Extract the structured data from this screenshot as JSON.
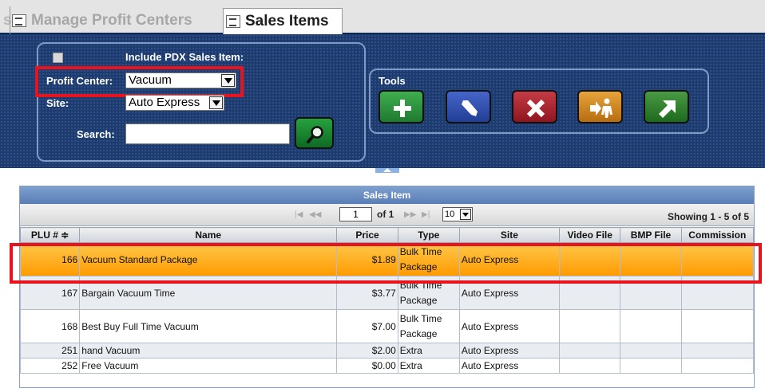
{
  "tabs": {
    "prev_tail": "s",
    "manage": "Manage Profit Centers",
    "sales": "Sales Items"
  },
  "filters": {
    "include_pdx_label": "Include PDX Sales Item:",
    "profit_center_label": "Profit Center:",
    "profit_center_value": "Vacuum",
    "site_label": "Site:",
    "site_value": "Auto Express",
    "search_label": "Search:",
    "search_value": ""
  },
  "tools": {
    "label": "Tools",
    "buttons": [
      "add-icon",
      "pencil-icon",
      "delete-x-icon",
      "move-person-icon",
      "arrow-up-right-icon"
    ]
  },
  "grid": {
    "title": "Sales Item",
    "pager": {
      "first": "|◀",
      "prev": "◀◀",
      "page": "1",
      "of": "of 1",
      "next": "▶▶",
      "last": "▶|",
      "page_size": "10",
      "showing": "Showing 1 - 5 of 5"
    },
    "columns": [
      "PLU # ≑",
      "Name",
      "Price",
      "Type",
      "Site",
      "Video File",
      "BMP File",
      "Commission"
    ],
    "rows": [
      {
        "plu": "166",
        "name": "Vacuum Standard Package",
        "price": "$1.89",
        "type1": "Bulk Time",
        "type2": "Package",
        "site": "Auto Express",
        "video": "",
        "bmp": "",
        "commission": ""
      },
      {
        "plu": "167",
        "name": "Bargain Vacuum Time",
        "price": "$3.77",
        "type1": "Bulk Time",
        "type2": "Package",
        "site": "Auto Express",
        "video": "",
        "bmp": "",
        "commission": ""
      },
      {
        "plu": "168",
        "name": "Best Buy Full Time Vacuum",
        "price": "$7.00",
        "type1": "Bulk Time",
        "type2": "Package",
        "site": "Auto Express",
        "video": "",
        "bmp": "",
        "commission": ""
      },
      {
        "plu": "251",
        "name": "hand Vacuum",
        "price": "$2.00",
        "type1": "Extra",
        "type2": "",
        "site": "Auto Express",
        "video": "",
        "bmp": "",
        "commission": ""
      },
      {
        "plu": "252",
        "name": "Free Vacuum",
        "price": "$0.00",
        "type1": "Extra",
        "type2": "",
        "site": "Auto Express",
        "video": "",
        "bmp": "",
        "commission": ""
      }
    ]
  },
  "colors": {
    "header_bg": "#1d3b6d",
    "highlight": "#e8131d",
    "selected_row": "#ffb020"
  }
}
